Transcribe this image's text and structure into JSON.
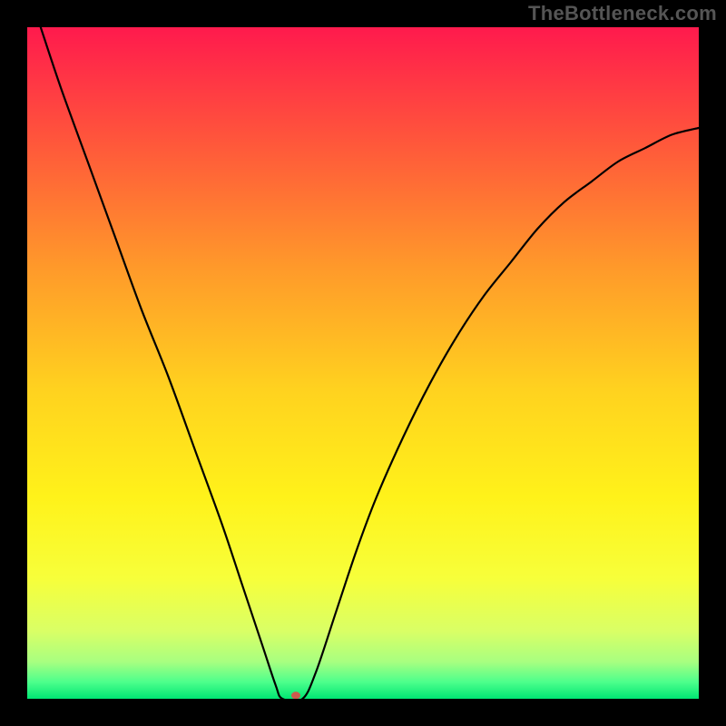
{
  "watermark": "TheBottleneck.com",
  "chart_data": {
    "type": "line",
    "title": "",
    "xlabel": "",
    "ylabel": "",
    "xlim": [
      0,
      100
    ],
    "ylim": [
      0,
      100
    ],
    "grid": false,
    "legend": false,
    "background_gradient_colors_top_to_bottom": [
      "#ff1a4d",
      "#ff5a3a",
      "#ff9a2a",
      "#ffd21f",
      "#fff21a",
      "#f7ff3a",
      "#d9ff66",
      "#a8ff80",
      "#4dff8c",
      "#00e673"
    ],
    "series": [
      {
        "name": "curve",
        "color": "#000000",
        "x": [
          2,
          5,
          9,
          13,
          17,
          21,
          25,
          29,
          32,
          35,
          37,
          38,
          41,
          43,
          46,
          49,
          52,
          56,
          60,
          64,
          68,
          72,
          76,
          80,
          84,
          88,
          92,
          96,
          100
        ],
        "y": [
          100,
          91,
          80,
          69,
          58,
          48,
          37,
          26,
          17,
          8,
          2,
          0,
          0,
          4,
          13,
          22,
          30,
          39,
          47,
          54,
          60,
          65,
          70,
          74,
          77,
          80,
          82,
          84,
          85
        ]
      }
    ],
    "marker": {
      "name": "bottleneck-point",
      "x": 40,
      "y": 0.5,
      "color": "#cc5a4d",
      "rx": 5,
      "ry": 4
    }
  }
}
